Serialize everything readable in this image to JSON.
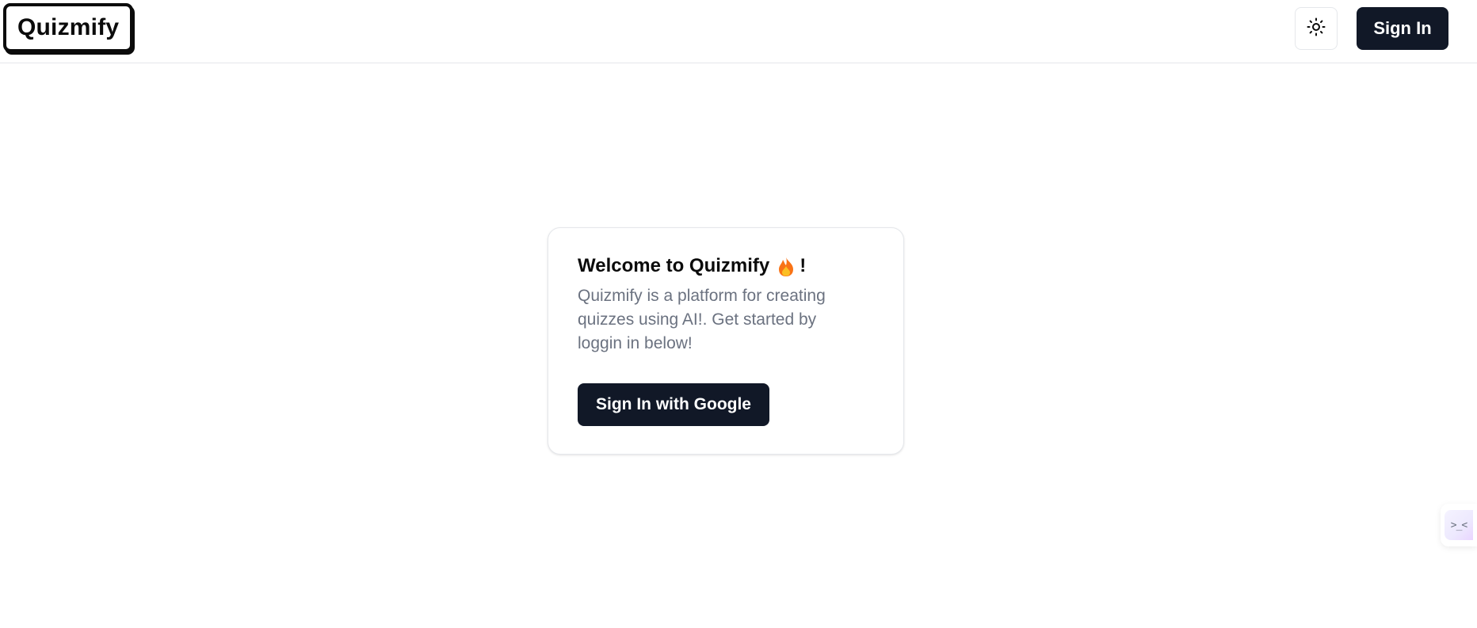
{
  "header": {
    "logo_text": "Quizmify",
    "theme_toggle_icon": "sun-icon",
    "signin_label": "Sign In"
  },
  "card": {
    "title": "Welcome to Quizmify",
    "title_suffix": "!",
    "title_icon": "flame-icon",
    "description": "Quizmify is a platform for creating quizzes using AI!. Get started by loggin in below!",
    "google_button_label": "Sign In with Google"
  },
  "side_widget": {
    "icon": "face-icon",
    "glyph": ">_<"
  },
  "colors": {
    "primary_dark": "#111827",
    "muted_text": "#6b7280",
    "border": "#e5e7eb",
    "flame_outer": "#f97316",
    "flame_inner": "#fbbf24"
  }
}
